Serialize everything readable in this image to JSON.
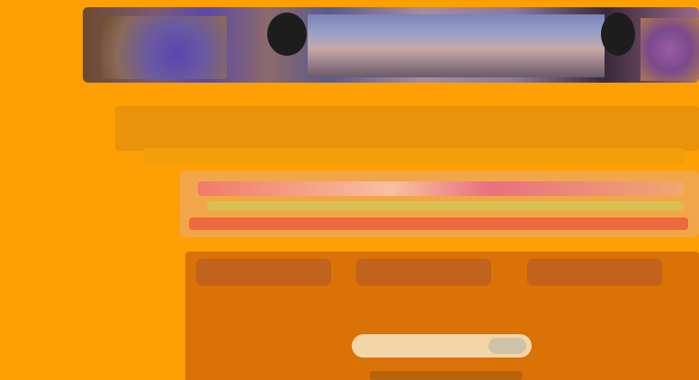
{
  "page": {
    "background": "#fea003"
  },
  "banner": {
    "left_image": "portrait-collage",
    "center_image": "mountain-landscape",
    "right_image": "portrait-collage"
  },
  "headline": {
    "text": ""
  },
  "menu": {
    "line1": "",
    "line2": "",
    "line3": ""
  },
  "tabs": [
    {
      "label": ""
    },
    {
      "label": ""
    },
    {
      "label": ""
    }
  ],
  "search": {
    "value": ""
  },
  "footer_text": ""
}
